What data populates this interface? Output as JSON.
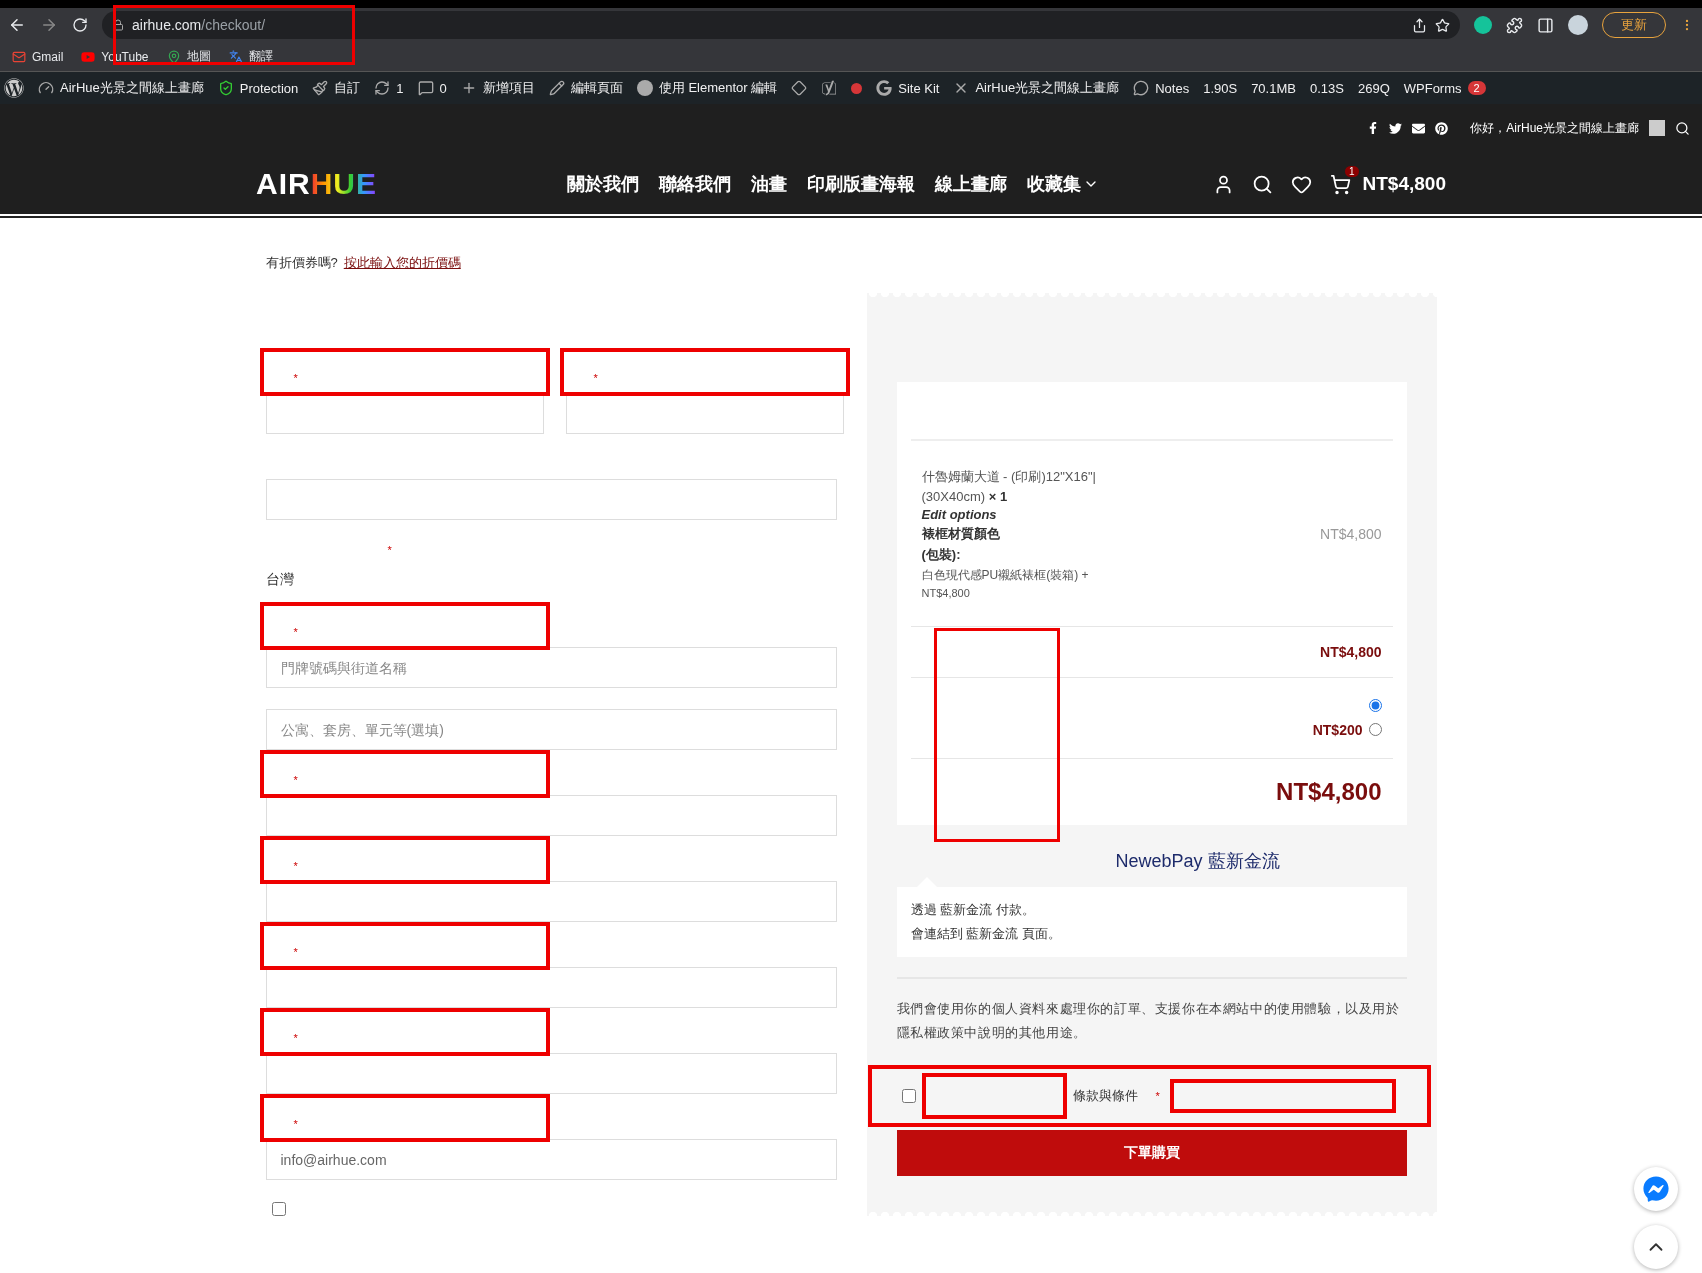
{
  "browser": {
    "url_host": "airhue.com",
    "url_path": "/checkout/",
    "update_button": "更新",
    "bookmarks": [
      "Gmail",
      "YouTube",
      "地圖",
      "翻譯"
    ]
  },
  "admin_bar": {
    "items": [
      "AirHue光景之間線上畫廊",
      "Protection",
      "自訂",
      "1",
      "0",
      "新增項目",
      "編輯頁面",
      "使用 Elementor 編輯",
      "Site Kit",
      "AirHue光景之間線上畫廊",
      "Notes",
      "1.90S",
      "70.1MB",
      "0.13S",
      "269Q",
      "WPForms"
    ],
    "wpforms_count": "2"
  },
  "site_header": {
    "greeting": "你好，AirHue光景之間線上畫廊",
    "logo": {
      "first": "AIR",
      "second": "HUE"
    },
    "nav": [
      {
        "label": "關於我們",
        "kind": "link"
      },
      {
        "label": "聯絡我們",
        "kind": "link"
      },
      {
        "label": "油畫",
        "kind": "link"
      },
      {
        "label": "印刷版畫海報",
        "kind": "link"
      },
      {
        "label": "線上畫廊",
        "kind": "link"
      },
      {
        "label": "收藏集",
        "kind": "dropdown"
      }
    ],
    "cart_count": "1",
    "cart_total": "NT$4,800"
  },
  "coupon": {
    "question": "有折價券嗎?",
    "link": "按此輸入您的折價碼"
  },
  "billing_fields": [
    {
      "kind": "pair",
      "fields": [
        {
          "framed": true,
          "mark": "*"
        },
        {
          "framed": true,
          "mark": "*"
        }
      ]
    },
    {
      "kind": "input",
      "framed": false
    },
    {
      "kind": "select",
      "framed": false,
      "mark": "*",
      "value": "台灣"
    },
    {
      "kind": "input",
      "framed": true,
      "mark": "*",
      "inputs": [
        {
          "placeholder": "門牌號碼與街道名稱"
        },
        {
          "placeholder": "公寓、套房、單元等(選填)"
        }
      ]
    },
    {
      "kind": "input",
      "framed": true,
      "mark": "*"
    },
    {
      "kind": "input",
      "framed": true,
      "mark": "*"
    },
    {
      "kind": "input",
      "framed": true,
      "mark": "*"
    },
    {
      "kind": "input",
      "framed": true,
      "mark": "*"
    },
    {
      "kind": "input",
      "framed": true,
      "mark": "*",
      "inputs": [
        {
          "value": "info@airhue.com"
        }
      ]
    }
  ],
  "create_account": {
    "checked": false
  },
  "order": {
    "item": {
      "name": "什魯姆蘭大道 - (印刷)12\"X16\"|",
      "size": "(30X40cm)",
      "qty": "× 1",
      "edit": "Edit options",
      "option_label": "裱框材質顏色",
      "option_label_2": "(包裝):",
      "option_value": "白色現代感PU襯紙裱框(裝箱) +",
      "option_price": "NT$4,800",
      "price": "NT$4,800"
    },
    "subtotal": "NT$4,800",
    "shipping": [
      {
        "selected": true
      },
      {
        "price": "NT$200",
        "selected": false
      }
    ],
    "total": "NT$4,800"
  },
  "payment": {
    "method": "NewebPay 藍新金流",
    "lines": [
      "透過 藍新金流 付款。",
      "會連結到 藍新金流 頁面。"
    ]
  },
  "privacy": "我們會使用你的個人資料來處理你的訂單、支援你在本網站中的使用體驗，以及用於隱私權政策中說明的其他用途。",
  "terms": {
    "checked": false,
    "label": "條款與條件",
    "mark": "*"
  },
  "place_order": "下單購買"
}
